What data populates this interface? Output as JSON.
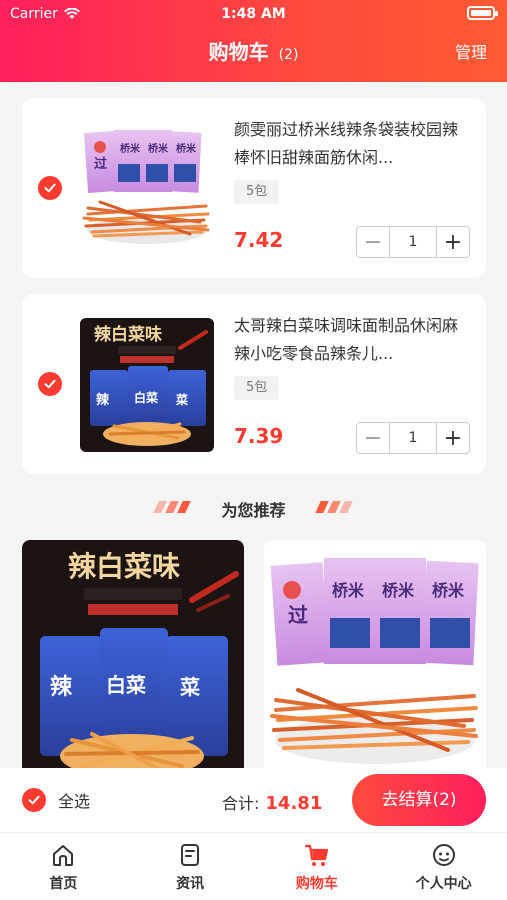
{
  "status_bar": {
    "carrier": "Carrier",
    "time": "1:48 AM"
  },
  "header": {
    "title": "购物车",
    "count": "(2)",
    "manage": "管理"
  },
  "cart_items": [
    {
      "title": "颜雯丽过桥米线辣条袋装校园辣棒怀旧甜辣面筋休闲...",
      "spec": "5包",
      "price": "7.42",
      "quantity": "1"
    },
    {
      "title": "太哥辣白菜味调味面制品休闲麻辣小吃零食品辣条儿...",
      "spec": "5包",
      "price": "7.39",
      "quantity": "1"
    }
  ],
  "recommend": {
    "title": "为您推荐"
  },
  "bottom_bar": {
    "select_all": "全选",
    "total_label": "合计:",
    "total_value": "14.81",
    "checkout": "去结算(2)"
  },
  "tabs": [
    {
      "label": "首页",
      "icon": "home-icon"
    },
    {
      "label": "资讯",
      "icon": "news-icon"
    },
    {
      "label": "购物车",
      "icon": "cart-icon",
      "active": true
    },
    {
      "label": "个人中心",
      "icon": "profile-icon"
    }
  ],
  "colors": {
    "accent": "#ff3b30",
    "header_start": "#ff1f5c",
    "header_end": "#ff5a32"
  }
}
